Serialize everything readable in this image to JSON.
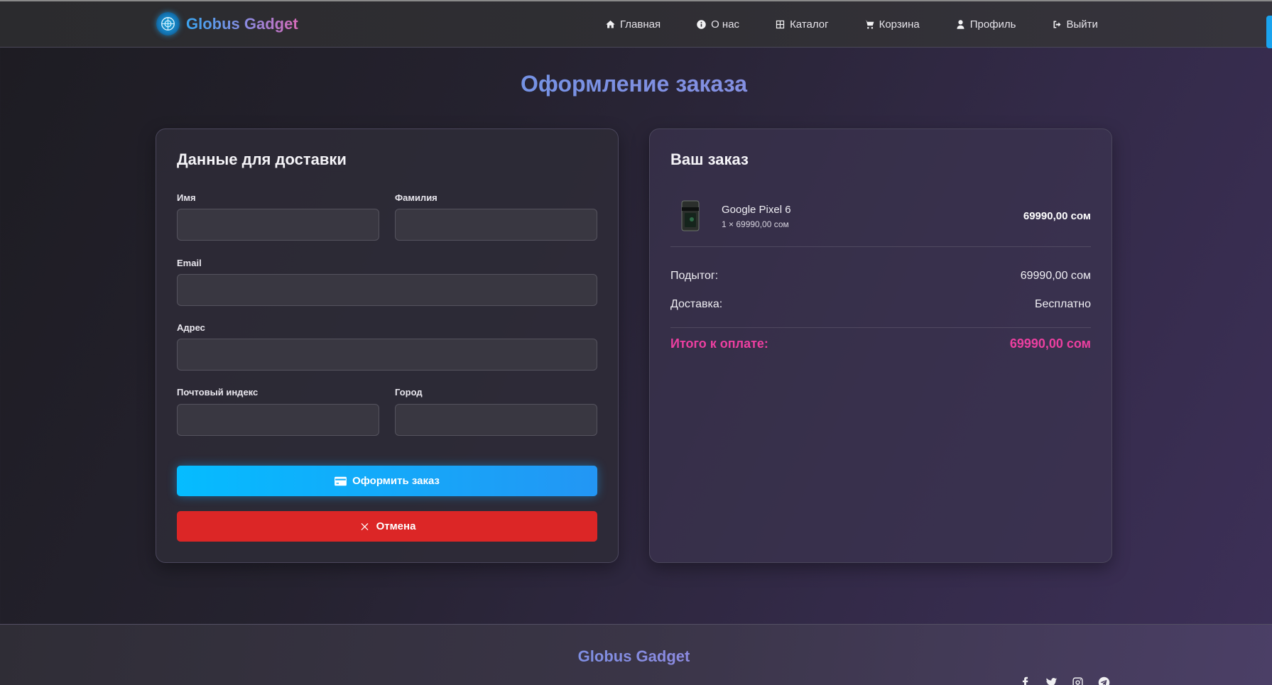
{
  "header": {
    "brand": "Globus Gadget",
    "nav": [
      {
        "label": "Главная",
        "icon": "home-icon"
      },
      {
        "label": "О нас",
        "icon": "info-icon"
      },
      {
        "label": "Каталог",
        "icon": "grid-icon"
      },
      {
        "label": "Корзина",
        "icon": "cart-icon"
      },
      {
        "label": "Профиль",
        "icon": "user-icon"
      },
      {
        "label": "Выйти",
        "icon": "logout-icon"
      }
    ]
  },
  "page": {
    "title": "Оформление заказа"
  },
  "delivery": {
    "heading": "Данные для доставки",
    "fields": {
      "first_name": {
        "label": "Имя",
        "value": "",
        "placeholder": ""
      },
      "last_name": {
        "label": "Фамилия",
        "value": "",
        "placeholder": ""
      },
      "email": {
        "label": "Email",
        "value": "",
        "placeholder": ""
      },
      "address": {
        "label": "Адрес",
        "value": "",
        "placeholder": ""
      },
      "postal_code": {
        "label": "Почтовый индекс",
        "value": "",
        "placeholder": ""
      },
      "city": {
        "label": "Город",
        "value": "",
        "placeholder": ""
      }
    },
    "submit_label": "Оформить заказ",
    "cancel_label": "Отмена"
  },
  "order": {
    "heading": "Ваш заказ",
    "items": [
      {
        "name": "Google Pixel 6",
        "qty_line": "1 × 69990,00 сом",
        "price": "69990,00 сом"
      }
    ],
    "subtotal_label": "Подытог:",
    "subtotal_value": "69990,00 сом",
    "shipping_label": "Доставка:",
    "shipping_value": "Бесплатно",
    "total_label": "Итого к оплате:",
    "total_value": "69990,00 сом"
  },
  "footer": {
    "brand": "Globus Gadget",
    "socials": [
      "facebook-icon",
      "twitter-icon",
      "instagram-icon",
      "telegram-icon"
    ]
  },
  "colors": {
    "accent_blue": "#05bcff",
    "cancel_red": "#dc2626",
    "total_pink": "#ec3fa0"
  }
}
